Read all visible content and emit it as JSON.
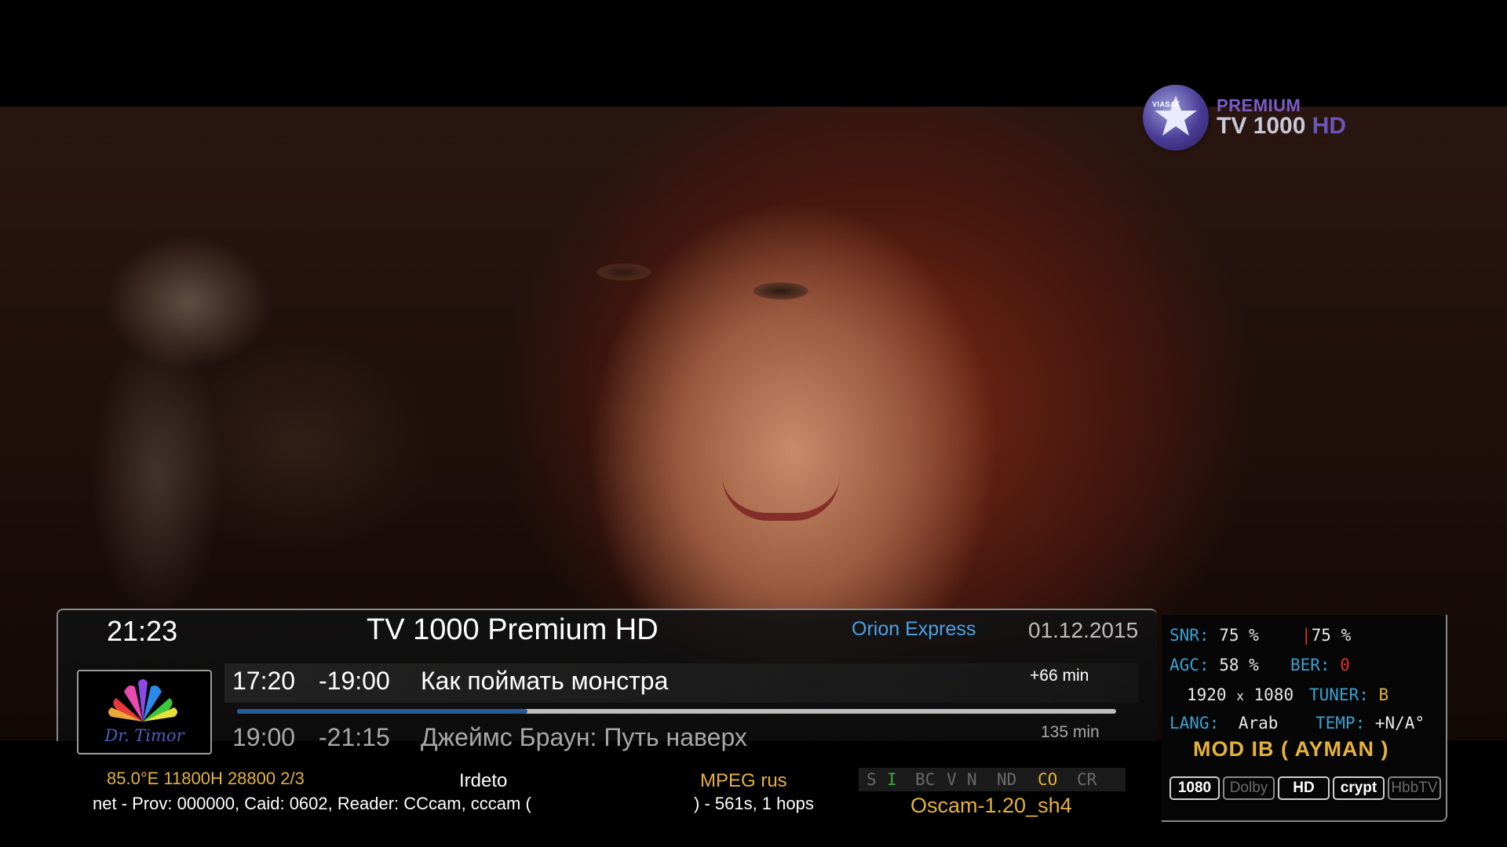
{
  "channel_logo": {
    "brand": "VIASAT",
    "line1": "PREMIUM",
    "line2": "TV 1000",
    "line2_hd": "HD",
    "icon": "viasat-star-logo"
  },
  "infobar": {
    "time": "21:23",
    "channel_name": "TV 1000 Premium HD",
    "satellite": "Orion Express",
    "date": "01.12.2015",
    "picon": {
      "icon": "dr-timor-picon",
      "text": "Dr. Timor"
    },
    "now": {
      "start": "17:20",
      "end": "-19:00",
      "title": "Как поймать монстра",
      "remaining": "+66 min"
    },
    "next": {
      "start": "19:00",
      "end": "-21:15",
      "title": "Джеймс Браун: Путь наверх",
      "duration": "135 min"
    },
    "progress_percent": 33,
    "transponder": "85.0°E 11800H 28800 2/3",
    "caid_system": "Irdeto",
    "audio": "MPEG rus",
    "ecm_info_left": "net - Prov: 000000, Caid: 0602, Reader: CCcam, cccam (",
    "ecm_info_right": ") - 561s, 1 hops",
    "cam": "Oscam-1.20_sh4",
    "ca_flags": [
      {
        "label": "S",
        "state": "off"
      },
      {
        "label": "I",
        "state": "on-green"
      },
      {
        "label": "BC",
        "state": "off"
      },
      {
        "label": "V",
        "state": "off"
      },
      {
        "label": "N",
        "state": "off"
      },
      {
        "label": "ND",
        "state": "off"
      },
      {
        "label": "CO",
        "state": "on-yellow"
      },
      {
        "label": "CR",
        "state": "off"
      }
    ]
  },
  "signal_panel": {
    "snr_label": "SNR:",
    "snr_value": "75 %",
    "snr_value2": "75 %",
    "agc_label": "AGC:",
    "agc_value": "58 %",
    "ber_label": "BER:",
    "ber_value": "0",
    "resolution_w": "1920",
    "resolution_x": "x",
    "resolution_h": "1080",
    "tuner_label": "TUNER:",
    "tuner_value": "B",
    "lang_label": "LANG:",
    "lang_value": "Arab",
    "temp_label": "TEMP:",
    "temp_value": "+N/A°",
    "mod_text": "MOD IB ( AYMAN )",
    "badges": [
      {
        "label": "1080",
        "active": true
      },
      {
        "label": "Dolby",
        "active": false
      },
      {
        "label": "HD",
        "active": true
      },
      {
        "label": "crypt",
        "active": true
      },
      {
        "label": "HbbTV",
        "active": false
      }
    ]
  },
  "colors": {
    "accent_blue": "#4aa2e8",
    "accent_yellow": "#e6b23a",
    "label_cyan": "#3aa0d0",
    "alert_red": "#e03030"
  }
}
